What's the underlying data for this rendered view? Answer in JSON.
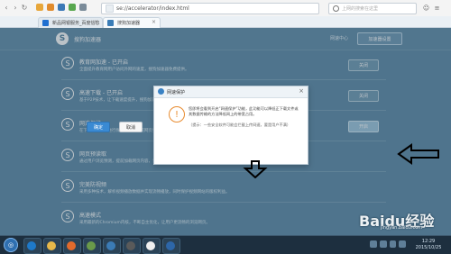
{
  "browser": {
    "url": "se://accelerator/index.html",
    "search_placeholder": "上网的搜索在这里"
  },
  "tabs": [
    {
      "label": "新品网银服务_百度信息"
    },
    {
      "label": "搜狗加速器"
    }
  ],
  "page": {
    "brand": "搜狗加速器",
    "speed_label": "网速中心",
    "speed_tip": "加速器设置"
  },
  "items": [
    {
      "name": "教育网加速 - 已开启",
      "desc": "全面提升教育网用户访问外网的速度，搜狗加速器免费提供。",
      "button": "关闭"
    },
    {
      "name": "高速下载 - 已开启",
      "desc": "基于P2P技术，让下载速度提升，搜狗加速器免费提供。",
      "button": "关闭"
    },
    {
      "name": "网速保护",
      "desc": "在下载时对网速进行保护，让您浏览网页更流畅。",
      "button": "开启"
    },
    {
      "name": "网页预读取",
      "desc": "通过用户浏览预测，提前加载网页内容，让你的页面更快打开。",
      "button": ""
    },
    {
      "name": "完美防视频",
      "desc": "采用多种技术，解析视频播放数据并实现流畅播放，同时保护视频网站的版权利益。",
      "button": ""
    },
    {
      "name": "高速模式",
      "desc": "采用最新的Chromium内核，不断自主优化，让用户更流畅的浏览网页。",
      "button": ""
    }
  ],
  "dialog": {
    "title": "网速保护",
    "message": "您即将会看到开启“网速保护”功能，此功能可以降低正下载文件或其数据传输的方法降低网上的带宽占用。",
    "hint": "（提示：一些安全软件可能会拦截上传网速，要是用户不满）",
    "ok": "确定",
    "cancel": "取消"
  },
  "watermark": {
    "big": "Baidu经验",
    "small": "jingyan.baidu.com"
  },
  "taskbar": {
    "time": "12:29",
    "date": "2015/10/25"
  }
}
